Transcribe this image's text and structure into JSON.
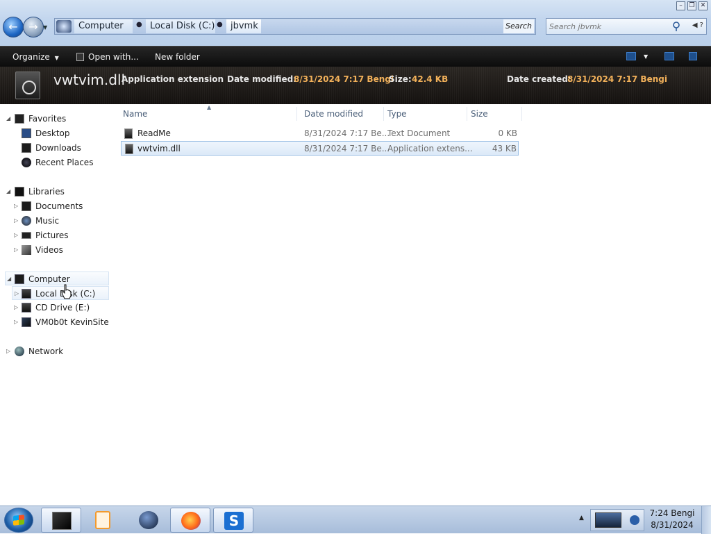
{
  "window": {
    "breadcrumb": [
      "Computer",
      "Local Disk (C:)",
      "jbvmk"
    ],
    "search_placeholder": "Search jbvmk",
    "search_extra_text": "Search l"
  },
  "toolbar": {
    "organize": "Organize",
    "open_with": "Open with...",
    "new_folder": "New folder"
  },
  "details": {
    "file_name": "vwtvim.dll",
    "type_value": "Application extension",
    "modified_label": "Date modified:",
    "modified_value": "8/31/2024 7:17 Bengi",
    "size_label": "Size:",
    "size_value": "42.4 KB",
    "created_label": "Date created:",
    "created_value": "8/31/2024 7:17 Bengi"
  },
  "nav": {
    "favorites": "Favorites",
    "desktop": "Desktop",
    "downloads": "Downloads",
    "recent_places": "Recent Places",
    "libraries": "Libraries",
    "documents": "Documents",
    "music": "Music",
    "pictures": "Pictures",
    "videos": "Videos",
    "computer": "Computer",
    "local_disk": "Local Disk (C:)",
    "cd_drive": "CD Drive (E:)",
    "vm_share": "VM0b0t KevinSite",
    "network": "Network"
  },
  "columns": {
    "name": "Name",
    "date_modified": "Date modified",
    "type": "Type",
    "size": "Size"
  },
  "files": [
    {
      "name": "ReadMe",
      "date": "8/31/2024 7:17 Be...",
      "type": "Text Document",
      "size": "0 KB"
    },
    {
      "name": "vwtvim.dll",
      "date": "8/31/2024 7:17 Be...",
      "type": "Application extens...",
      "size": "43 KB"
    }
  ],
  "taskbar": {
    "time": "7:24 Bengi",
    "date": "8/31/2024",
    "apps": [
      "file-explorer",
      "media-player",
      "globe-app",
      "firefox",
      "sophos-s"
    ]
  },
  "colors": {
    "details_value": "#f2b15a",
    "selection": "#dce9f8",
    "command_bar": "#111111"
  }
}
